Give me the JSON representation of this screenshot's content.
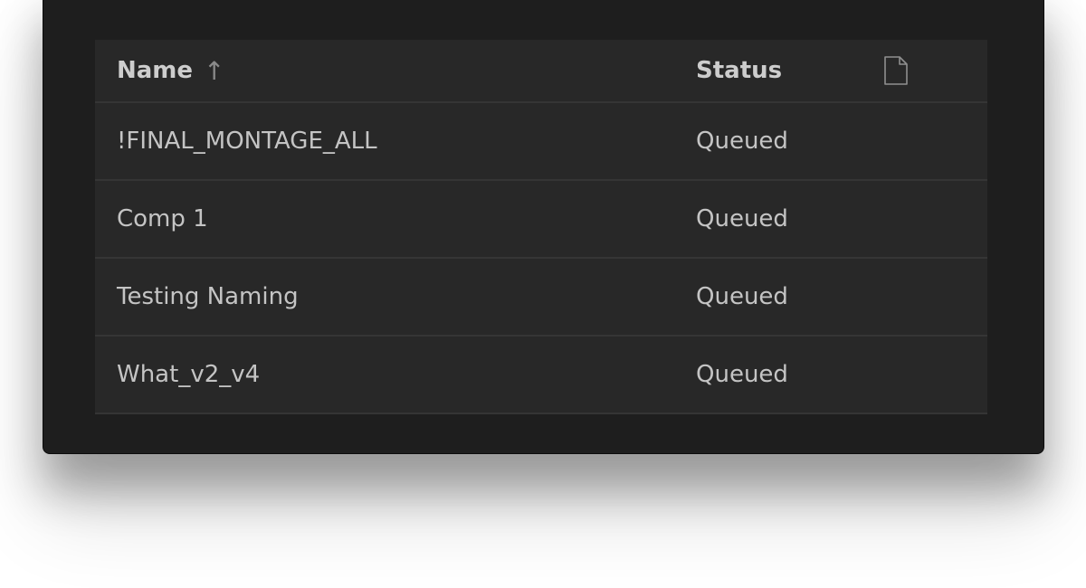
{
  "table": {
    "columns": {
      "name_label": "Name",
      "sort_glyph": "↑",
      "status_label": "Status",
      "file_column_icon": "file-icon"
    },
    "rows": [
      {
        "name": "!FINAL_MONTAGE_ALL",
        "status": "Queued"
      },
      {
        "name": "Comp 1",
        "status": "Queued"
      },
      {
        "name": "Testing Naming",
        "status": "Queued"
      },
      {
        "name": "What_v2_v4",
        "status": "Queued"
      }
    ]
  },
  "colors": {
    "window_bg": "#1e1e1e",
    "panel_bg": "#282828",
    "text": "#c4c4c4",
    "divider": "#353535"
  }
}
